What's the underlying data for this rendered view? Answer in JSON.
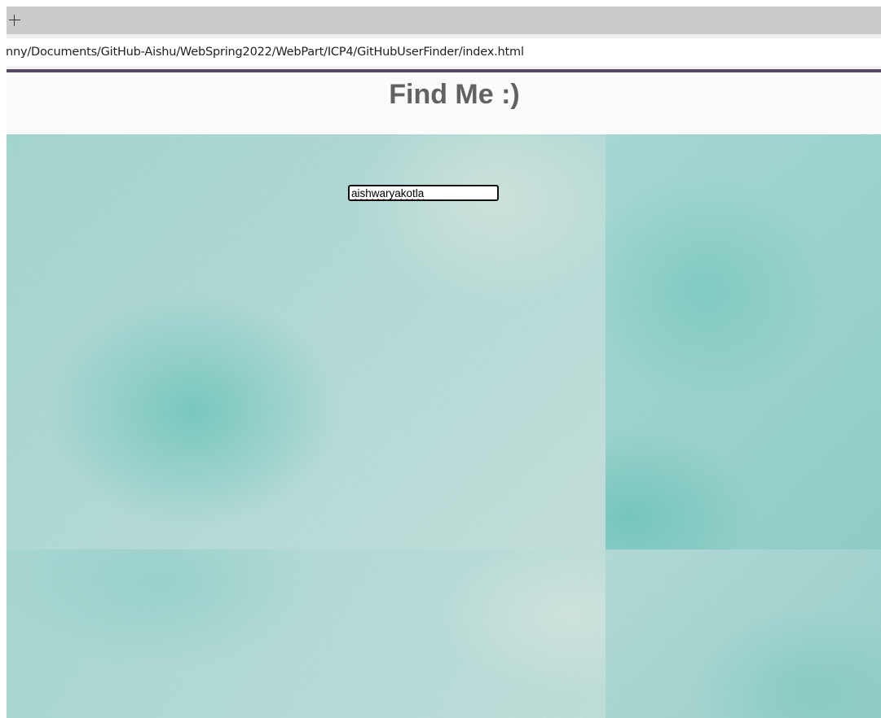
{
  "browser": {
    "tab_strip": {
      "new_tab_icon": "plus-icon"
    },
    "address_bar": {
      "url": "nny/Documents/GitHub-Aishu/WebSpring2022/WebPart/ICP4/GitHubUserFinder/index.html"
    },
    "accent_color": "#564a6a"
  },
  "page": {
    "title": "Find Me :)",
    "title_color": "#626262",
    "background_colors": [
      "#a6dad5",
      "#bde2de",
      "#8fd1cb"
    ],
    "search": {
      "value": "aishwaryakotla",
      "placeholder": ""
    }
  }
}
